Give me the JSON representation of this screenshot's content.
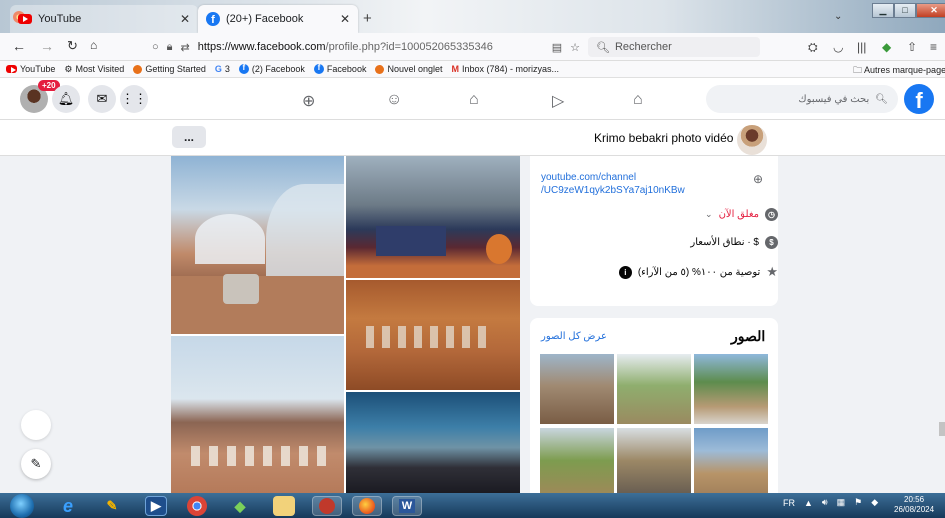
{
  "browser": {
    "tabs": [
      {
        "title": "YouTube",
        "active": false
      },
      {
        "title": "(20+) Facebook",
        "active": true
      }
    ],
    "new_tab": "+",
    "url_prefix": "https://www.",
    "url_domain": "facebook.com",
    "url_path": "/profile.php?id=100052065335346",
    "search_placeholder": "Rechercher",
    "bookmarks": [
      {
        "label": "YouTube",
        "icon": "youtube-icon"
      },
      {
        "label": "Most Visited",
        "icon": "gear-icon"
      },
      {
        "label": "Getting Started",
        "icon": "firefox-icon"
      },
      {
        "label": "3",
        "icon": "google-icon"
      },
      {
        "label": "(2) Facebook",
        "icon": "facebook-icon"
      },
      {
        "label": "Facebook",
        "icon": "facebook-icon"
      },
      {
        "label": "Nouvel onglet",
        "icon": "firefox-icon"
      },
      {
        "label": "Inbox (784) - morizyas...",
        "icon": "gmail-icon"
      }
    ],
    "other_bookmarks": "Autres marque-pages"
  },
  "facebook": {
    "notification_badge": "+20",
    "search_placeholder": "بحث في فيسبوك",
    "profile_name": "Krimo bebakri photo vidéo",
    "more_button": "...",
    "intro": {
      "link_line1": "youtube.com/channel",
      "link_line2": "/UC9zeW1qyk2bSYa7aj10nKBw",
      "status": "مغلق الآن",
      "price_range": "نطاق الأسعار · $",
      "rating": "توصية من ١٠٠% (٥ من الآراء)"
    },
    "photos_card": {
      "title": "الصور",
      "see_all": "عرض كل الصور"
    }
  },
  "taskbar": {
    "language": "FR",
    "time": "20:56",
    "date": "26/08/2024"
  },
  "colors": {
    "facebook_blue": "#1877f2",
    "link_blue": "#216fdb",
    "closed_red": "#e41e3f",
    "page_bg": "#f0f2f5"
  }
}
